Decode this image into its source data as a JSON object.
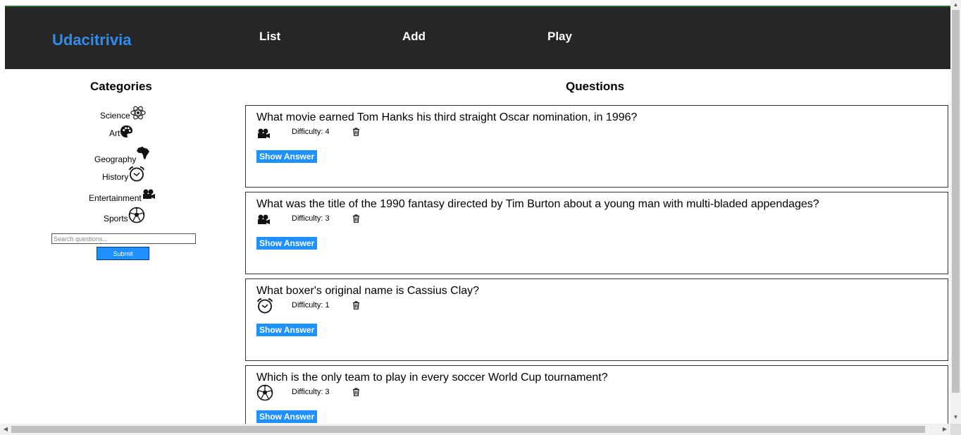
{
  "header": {
    "brand": "Udacitrivia",
    "nav": [
      {
        "label": "List"
      },
      {
        "label": "Add"
      },
      {
        "label": "Play"
      }
    ]
  },
  "sidebar": {
    "title": "Categories",
    "categories": [
      {
        "label": "Science",
        "icon": "atom-icon"
      },
      {
        "label": "Art",
        "icon": "palette-icon"
      },
      {
        "label": "Geography",
        "icon": "africa-icon"
      },
      {
        "label": "History",
        "icon": "alarm-clock-icon"
      },
      {
        "label": "Entertainment",
        "icon": "film-camera-icon"
      },
      {
        "label": "Sports",
        "icon": "soccer-ball-icon"
      }
    ],
    "search_placeholder": "Search questions...",
    "submit_label": "Submit"
  },
  "main": {
    "title": "Questions",
    "questions": [
      {
        "text": "What movie earned Tom Hanks his third straight Oscar nomination, in 1996?",
        "category_icon": "film-camera-icon",
        "difficulty": "Difficulty: 4",
        "show_answer": "Show Answer"
      },
      {
        "text": "What was the title of the 1990 fantasy directed by Tim Burton about a young man with multi-bladed appendages?",
        "category_icon": "film-camera-icon",
        "difficulty": "Difficulty: 3",
        "show_answer": "Show Answer"
      },
      {
        "text": "What boxer's original name is Cassius Clay?",
        "category_icon": "alarm-clock-icon",
        "difficulty": "Difficulty: 1",
        "show_answer": "Show Answer"
      },
      {
        "text": "Which is the only team to play in every soccer World Cup tournament?",
        "category_icon": "soccer-ball-icon",
        "difficulty": "Difficulty: 3",
        "show_answer": "Show Answer"
      }
    ]
  },
  "colors": {
    "header_bg": "#262626",
    "brand": "#2f8ded",
    "button": "#1e90ff"
  }
}
